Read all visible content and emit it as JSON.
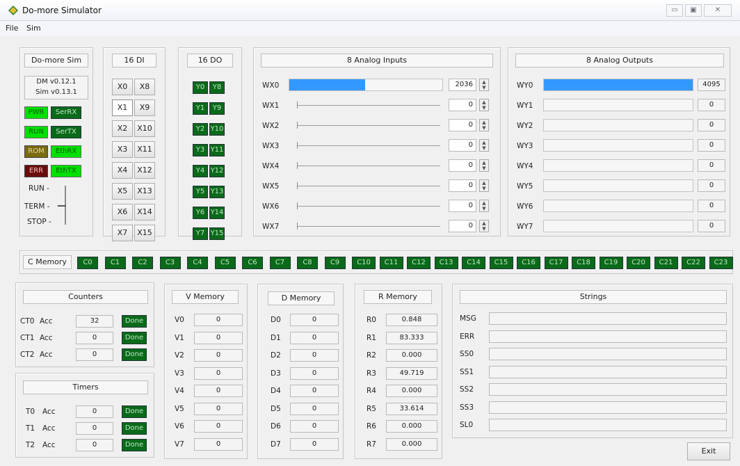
{
  "window": {
    "title": "Do-more Simulator",
    "buttons": [
      "▭",
      "▣",
      "✕"
    ]
  },
  "menu": [
    "File",
    "Sim"
  ],
  "status_panel": {
    "title": "Do-more Sim",
    "dm_version": "DM v0.12.1",
    "sim_version": "Sim v0.13.1",
    "leds": [
      {
        "label": "PWR",
        "state": "on"
      },
      {
        "label": "SerRX",
        "state": "dark"
      },
      {
        "label": "RUN",
        "state": "on"
      },
      {
        "label": "SerTX",
        "state": "dark"
      },
      {
        "label": "ROM",
        "state": "olive"
      },
      {
        "label": "EthRX",
        "state": "on"
      },
      {
        "label": "ERR",
        "state": "red"
      },
      {
        "label": "EthTX",
        "state": "on"
      }
    ],
    "switch": {
      "run": "RUN -",
      "term": "TERM -",
      "stop": "STOP -"
    }
  },
  "di": {
    "title": "16 DI",
    "left": [
      "X0",
      "X1",
      "X2",
      "X3",
      "X4",
      "X5",
      "X6",
      "X7"
    ],
    "right": [
      "X8",
      "X9",
      "X10",
      "X11",
      "X12",
      "X13",
      "X14",
      "X15"
    ]
  },
  "do": {
    "title": "16 DO",
    "left": [
      "Y0",
      "Y1",
      "Y2",
      "Y3",
      "Y4",
      "Y5",
      "Y6",
      "Y7"
    ],
    "right": [
      "Y8",
      "Y9",
      "Y10",
      "Y11",
      "Y12",
      "Y13",
      "Y14",
      "Y15"
    ]
  },
  "analog_in": {
    "title": "8 Analog Inputs",
    "rows": [
      {
        "label": "WX0",
        "value": "2036",
        "level": 0.497
      },
      {
        "label": "WX1",
        "value": "0",
        "level": 0
      },
      {
        "label": "WX2",
        "value": "0",
        "level": 0
      },
      {
        "label": "WX3",
        "value": "0",
        "level": 0
      },
      {
        "label": "WX4",
        "value": "0",
        "level": 0
      },
      {
        "label": "WX5",
        "value": "0",
        "level": 0
      },
      {
        "label": "WX6",
        "value": "0",
        "level": 0
      },
      {
        "label": "WX7",
        "value": "0",
        "level": 0
      }
    ]
  },
  "analog_out": {
    "title": "8 Analog Outputs",
    "rows": [
      {
        "label": "WY0",
        "value": "4095",
        "level": 1
      },
      {
        "label": "WY1",
        "value": "0",
        "level": 0
      },
      {
        "label": "WY2",
        "value": "0",
        "level": 0
      },
      {
        "label": "WY3",
        "value": "0",
        "level": 0
      },
      {
        "label": "WY4",
        "value": "0",
        "level": 0
      },
      {
        "label": "WY5",
        "value": "0",
        "level": 0
      },
      {
        "label": "WY6",
        "value": "0",
        "level": 0
      },
      {
        "label": "WY7",
        "value": "0",
        "level": 0
      }
    ]
  },
  "c_memory": {
    "title": "C Memory",
    "items": [
      "C0",
      "C1",
      "C2",
      "C3",
      "C4",
      "C5",
      "C6",
      "C7",
      "C8",
      "C9",
      "C10",
      "C11",
      "C12",
      "C13",
      "C14",
      "C15",
      "C16",
      "C17",
      "C18",
      "C19",
      "C20",
      "C21",
      "C22",
      "C23"
    ]
  },
  "counters": {
    "title": "Counters",
    "rows": [
      {
        "name": "CT0",
        "acc": "Acc",
        "value": "32",
        "done": "Done"
      },
      {
        "name": "CT1",
        "acc": "Acc",
        "value": "0",
        "done": "Done"
      },
      {
        "name": "CT2",
        "acc": "Acc",
        "value": "0",
        "done": "Done"
      }
    ]
  },
  "timers": {
    "title": "Timers",
    "rows": [
      {
        "name": "T0",
        "acc": "Acc",
        "value": "0",
        "done": "Done"
      },
      {
        "name": "T1",
        "acc": "Acc",
        "value": "0",
        "done": "Done"
      },
      {
        "name": "T2",
        "acc": "Acc",
        "value": "0",
        "done": "Done"
      }
    ]
  },
  "v_memory": {
    "title": "V Memory",
    "rows": [
      {
        "name": "V0",
        "value": "0"
      },
      {
        "name": "V1",
        "value": "0"
      },
      {
        "name": "V2",
        "value": "0"
      },
      {
        "name": "V3",
        "value": "0"
      },
      {
        "name": "V4",
        "value": "0"
      },
      {
        "name": "V5",
        "value": "0"
      },
      {
        "name": "V6",
        "value": "0"
      },
      {
        "name": "V7",
        "value": "0"
      }
    ]
  },
  "d_memory": {
    "title": "D Memory",
    "rows": [
      {
        "name": "D0",
        "value": "0"
      },
      {
        "name": "D1",
        "value": "0"
      },
      {
        "name": "D2",
        "value": "0"
      },
      {
        "name": "D3",
        "value": "0"
      },
      {
        "name": "D4",
        "value": "0"
      },
      {
        "name": "D5",
        "value": "0"
      },
      {
        "name": "D6",
        "value": "0"
      },
      {
        "name": "D7",
        "value": "0"
      }
    ]
  },
  "r_memory": {
    "title": "R Memory",
    "rows": [
      {
        "name": "R0",
        "value": "0.848"
      },
      {
        "name": "R1",
        "value": "83.333"
      },
      {
        "name": "R2",
        "value": "0.000"
      },
      {
        "name": "R3",
        "value": "49.719"
      },
      {
        "name": "R4",
        "value": "0.000"
      },
      {
        "name": "R5",
        "value": "33.614"
      },
      {
        "name": "R6",
        "value": "0.000"
      },
      {
        "name": "R7",
        "value": "0.000"
      }
    ]
  },
  "strings": {
    "title": "Strings",
    "rows": [
      {
        "name": "MSG",
        "value": ""
      },
      {
        "name": "ERR",
        "value": ""
      },
      {
        "name": "SS0",
        "value": ""
      },
      {
        "name": "SS1",
        "value": ""
      },
      {
        "name": "SS2",
        "value": ""
      },
      {
        "name": "SS3",
        "value": ""
      },
      {
        "name": "SL0",
        "value": ""
      }
    ]
  },
  "exit_label": "Exit",
  "colors": {
    "led_on": "#00e000",
    "led_dark": "#0a6a1a",
    "bar_fill": "#3399ff"
  }
}
